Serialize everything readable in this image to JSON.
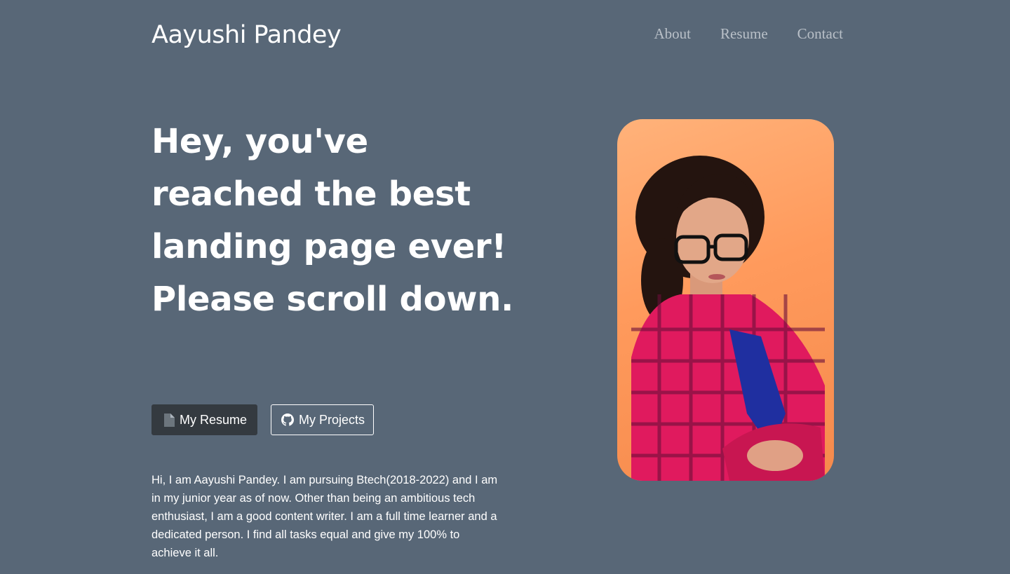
{
  "header": {
    "brand": "Aayushi Pandey",
    "nav": [
      {
        "label": "About"
      },
      {
        "label": "Resume"
      },
      {
        "label": "Contact"
      }
    ]
  },
  "hero": {
    "title": "Hey, you've reached the best landing page ever! Please scroll down.",
    "buttons": {
      "resume": {
        "label": "My Resume",
        "icon": "file-icon"
      },
      "projects": {
        "label": "My Projects",
        "icon": "github-icon"
      }
    },
    "bio": "Hi, I am Aayushi Pandey. I am pursuing Btech(2018-2022) and I am in my junior year as of now. Other than being an ambitious tech enthusiast, I am a good content writer. I am a full time learner and a dedicated person. I find all tasks equal and give my 100% to achieve it all."
  },
  "colors": {
    "background": "#586777",
    "nav_link": "#b9c0c8",
    "dark_button": "#343a40",
    "photo_background": "#ff9a5c"
  }
}
